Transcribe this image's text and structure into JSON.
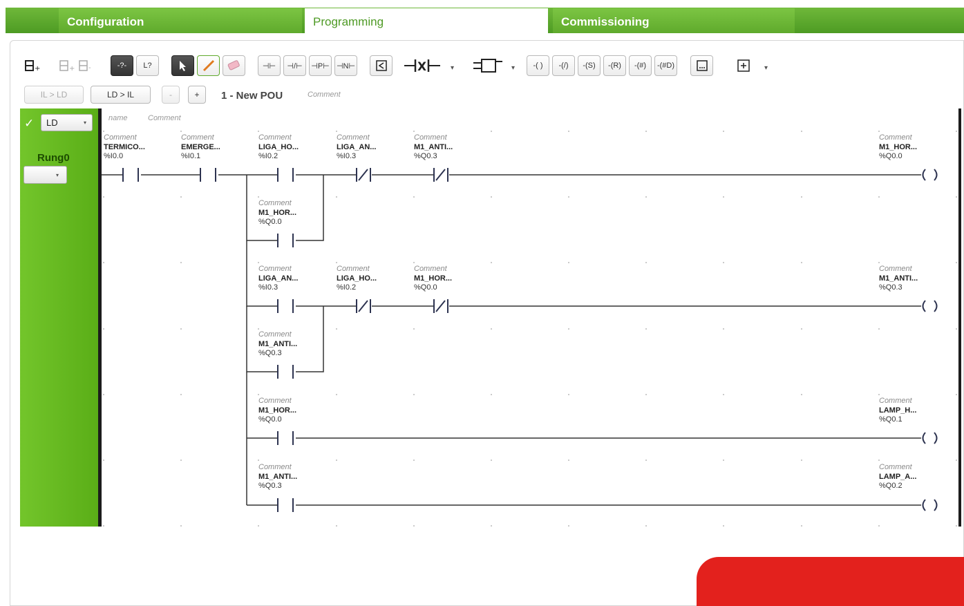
{
  "tabs": [
    {
      "label": "Configuration",
      "active": false
    },
    {
      "label": "Programming",
      "active": true
    },
    {
      "label": "Commissioning",
      "active": false
    }
  ],
  "toolbar": {
    "il_to_ld": "IL > LD",
    "ld_to_il": "LD > IL",
    "minus": "-",
    "plus": "+",
    "dropdown_caret": "▾",
    "contact_glyphs": {
      "normal": "⊣⊢",
      "negated": "⊣/⊢",
      "positive": "⊣P⊢",
      "negative": "⊣N⊢"
    },
    "coil_glyphs": [
      "-( )",
      "-(/)",
      "-(S)",
      "-(R)",
      "-(#)",
      "-(#D)"
    ],
    "unknown_label": "-?-",
    "jump_label": "L?"
  },
  "pou": {
    "title": "1 - New POU",
    "comment": "Comment"
  },
  "rung": {
    "check": "✓",
    "language": "LD",
    "name": "Rung0",
    "header_name": "name",
    "header_comment": "Comment"
  },
  "elements": [
    {
      "comment": "Comment",
      "name": "TERMICO...",
      "address": "%I0.0"
    },
    {
      "comment": "Comment",
      "name": "EMERGE...",
      "address": "%I0.1"
    },
    {
      "comment": "Comment",
      "name": "LIGA_HO...",
      "address": "%I0.2"
    },
    {
      "comment": "Comment",
      "name": "LIGA_AN...",
      "address": "%I0.3"
    },
    {
      "comment": "Comment",
      "name": "M1_ANTI...",
      "address": "%Q0.3"
    },
    {
      "comment": "Comment",
      "name": "M1_HOR...",
      "address": "%Q0.0"
    },
    {
      "comment": "Comment",
      "name": "M1_HOR...",
      "address": "%Q0.0"
    },
    {
      "comment": "Comment",
      "name": "LIGA_AN...",
      "address": "%I0.3"
    },
    {
      "comment": "Comment",
      "name": "LIGA_HO...",
      "address": "%I0.2"
    },
    {
      "comment": "Comment",
      "name": "M1_HOR...",
      "address": "%Q0.0"
    },
    {
      "comment": "Comment",
      "name": "M1_ANTI...",
      "address": "%Q0.3"
    },
    {
      "comment": "Comment",
      "name": "M1_ANTI...",
      "address": "%Q0.3"
    },
    {
      "comment": "Comment",
      "name": "M1_HOR...",
      "address": "%Q0.0"
    },
    {
      "comment": "Comment",
      "name": "LAMP_H...",
      "address": "%Q0.1"
    },
    {
      "comment": "Comment",
      "name": "M1_ANTI...",
      "address": "%Q0.3"
    },
    {
      "comment": "Comment",
      "name": "LAMP_A...",
      "address": "%Q0.2"
    }
  ],
  "colors": {
    "accent_green": "#5faa2c",
    "brand_red": "#e3211d",
    "rail": "#1c1c1c"
  }
}
